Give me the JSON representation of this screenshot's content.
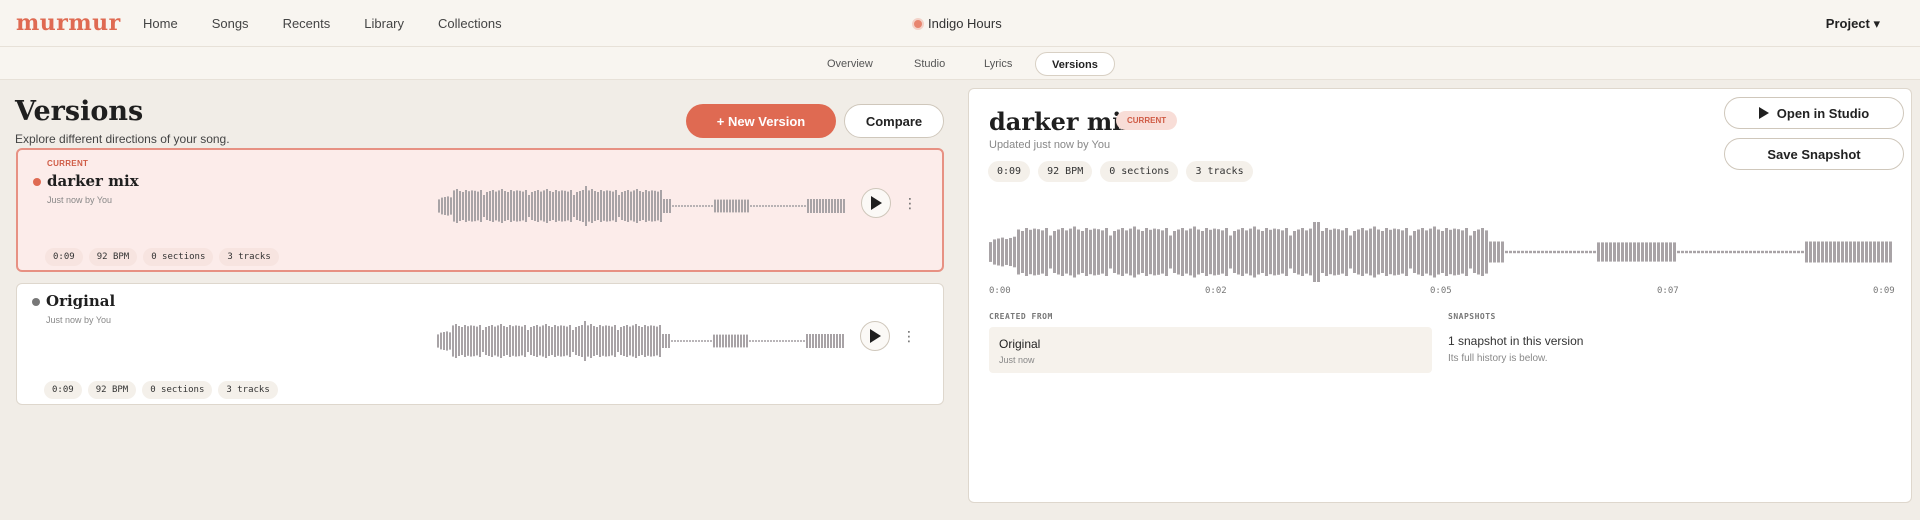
{
  "app": {
    "logo": "murmur",
    "nav": [
      "Home",
      "Songs",
      "Recents",
      "Library",
      "Collections"
    ],
    "project_title": "Indigo Hours",
    "project_menu": "Project ▾"
  },
  "subtabs": [
    "Overview",
    "Studio",
    "Lyrics",
    "Versions"
  ],
  "page": {
    "title": "Versions",
    "subtitle": "Explore different directions of your song.",
    "new_version_label": "+  New Version",
    "compare_label": "Compare"
  },
  "versions": [
    {
      "tag": "CURRENT",
      "name": "darker mix",
      "meta": "Just now by You",
      "chips": [
        "0:09",
        "92 BPM",
        "0 sections",
        "3 tracks"
      ]
    },
    {
      "tag": "",
      "name": "Original",
      "meta": "Just now by You",
      "chips": [
        "0:09",
        "92 BPM",
        "0 sections",
        "3 tracks"
      ]
    }
  ],
  "detail": {
    "title": "darker mix",
    "badge": "CURRENT",
    "updated": "Updated just now by You",
    "chips": [
      "0:09",
      "92 BPM",
      "0 sections",
      "3 tracks"
    ],
    "open_label": "Open in Studio",
    "snapshot_label": "Save Snapshot",
    "ticks": [
      "0:00",
      "0:02",
      "0:05",
      "0:07",
      "0:09"
    ],
    "created_from_label": "CREATED FROM",
    "created_from_name": "Original",
    "created_from_meta": "Just now",
    "snapshots_label": "SNAPSHOTS",
    "snapshots_line": "1 snapshot in this version",
    "snapshots_sub": "Its full history is below."
  },
  "colors": {
    "accent": "#df6a52",
    "wave": "#a8a3a6"
  }
}
